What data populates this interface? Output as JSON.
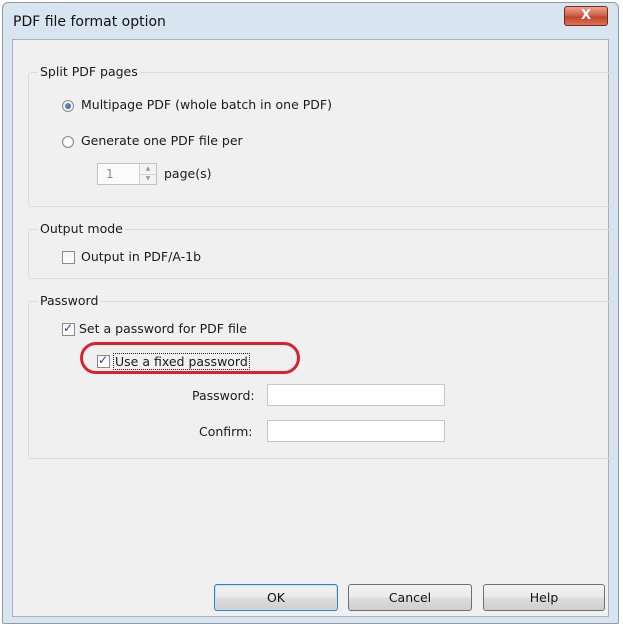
{
  "window": {
    "title": "PDF file format option",
    "close_glyph": "X"
  },
  "split_group": {
    "label": "Split PDF pages",
    "multipage_label": "Multipage PDF (whole batch in one PDF)",
    "multipage_selected": true,
    "generate_label": "Generate one PDF file per",
    "generate_selected": false,
    "pages_value": "1",
    "pages_unit": "page(s)",
    "spin_up_glyph": "▲",
    "spin_down_glyph": "▼"
  },
  "output_group": {
    "label": "Output mode",
    "pdfa_label": "Output in PDF/A-1b",
    "pdfa_checked": false
  },
  "password_group": {
    "label": "Password",
    "set_password_label": "Set a password for PDF file",
    "set_password_checked": true,
    "fixed_password_label": "Use a fixed password",
    "fixed_password_checked": true,
    "password_label": "Password:",
    "password_value": "",
    "confirm_label": "Confirm:",
    "confirm_value": ""
  },
  "check_glyph": "✓",
  "buttons": {
    "ok": "OK",
    "cancel": "Cancel",
    "help": "Help"
  },
  "colors": {
    "highlight": "#d9222d",
    "close_button": "#c1452c"
  }
}
